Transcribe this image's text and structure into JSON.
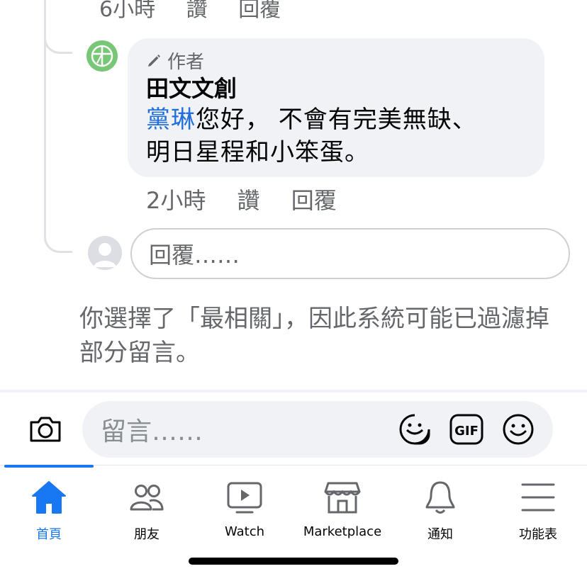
{
  "previous_reply": {
    "time": "6小時",
    "like": "讚",
    "reply": "回覆"
  },
  "author_reply": {
    "badge": "作者",
    "name": "田文文創",
    "mention": "黨琳",
    "text_line1": "您好， 不會有完美無缺、",
    "text_line2": "明日星程和小笨蛋。",
    "time": "2小時",
    "like": "讚",
    "reply": "回覆"
  },
  "reply_box": {
    "placeholder": "回覆……"
  },
  "filter_note": "你選擇了「最相關」，因此系統可能已過濾掉部分留言。",
  "comment_bar": {
    "placeholder": "留言……",
    "icons": [
      "camera-icon",
      "sticker-icon",
      "gif-icon",
      "emoji-icon"
    ],
    "gif_label": "GIF"
  },
  "bottom_nav": {
    "items": [
      {
        "label": "首頁",
        "icon": "home-icon",
        "active": true
      },
      {
        "label": "朋友",
        "icon": "friends-icon",
        "active": false
      },
      {
        "label": "Watch",
        "icon": "watch-icon",
        "active": false
      },
      {
        "label": "Marketplace",
        "icon": "marketplace-icon",
        "active": false
      },
      {
        "label": "通知",
        "icon": "bell-icon",
        "active": false
      },
      {
        "label": "功能表",
        "icon": "menu-icon",
        "active": false
      }
    ]
  },
  "colors": {
    "accent": "#1877f2",
    "mention": "#216fdb",
    "muted": "#65676b",
    "bubble": "#f0f2f5"
  }
}
